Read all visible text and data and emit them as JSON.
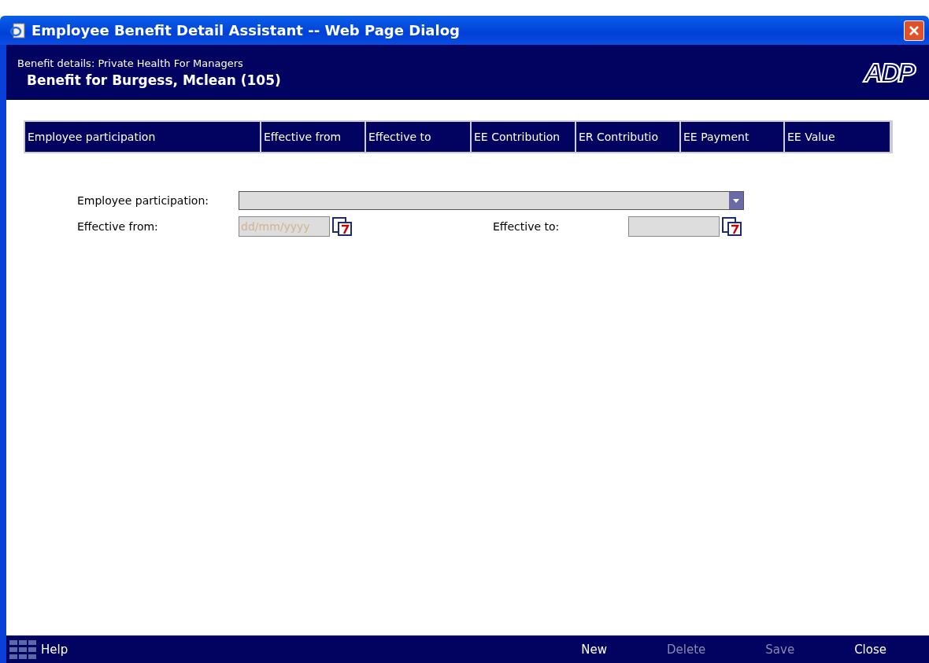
{
  "window": {
    "title": "Employee Benefit Detail Assistant -- Web Page Dialog"
  },
  "header": {
    "subtitle": "Benefit details: Private Health For Managers",
    "title": "Benefit for Burgess, Mclean (105)",
    "logo": "ADP"
  },
  "table": {
    "columns": [
      "Employee participation",
      "Effective from",
      "Effective to",
      "EE Contribution",
      "ER Contributio",
      "EE Payment",
      "EE Value"
    ]
  },
  "form": {
    "participation_label": "Employee participation:",
    "from_label": "Effective from:",
    "from_placeholder": "dd/mm/yyyy",
    "to_label": "Effective to:"
  },
  "footer": {
    "help": "Help",
    "buttons": [
      {
        "label": "New",
        "disabled": false
      },
      {
        "label": "Delete",
        "disabled": true
      },
      {
        "label": "Save",
        "disabled": true
      },
      {
        "label": "Close",
        "disabled": false
      }
    ]
  }
}
